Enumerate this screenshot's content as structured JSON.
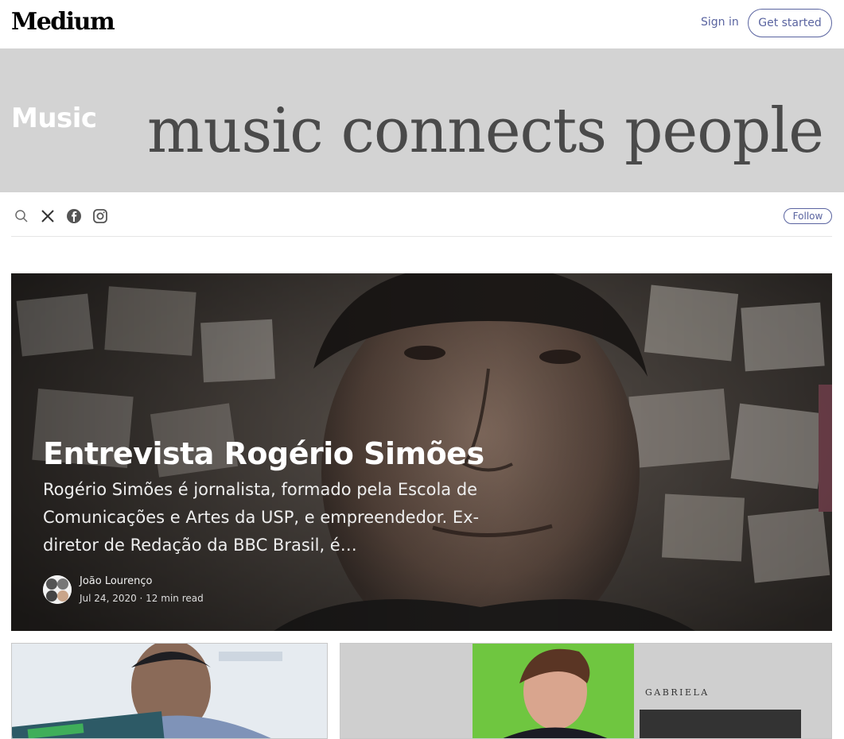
{
  "header": {
    "logo": "Medium",
    "sign_in": "Sign in",
    "get_started": "Get started"
  },
  "publication": {
    "name": "Music",
    "banner_text": "music connects people",
    "follow": "Follow",
    "social_icons": [
      "search-icon",
      "x-icon",
      "facebook-icon",
      "instagram-icon"
    ]
  },
  "hero": {
    "title": "Entrevista Rogério Simões",
    "subtitle": "Rogério Simões é jornalista, formado pela Escola de Comunicações e Artes da USP, e empreendedor. Ex-diretor de Redação da BBC Brasil, é…",
    "author": "João Lourenço",
    "meta": "Jul 24, 2020 · 12 min read"
  },
  "cards": {
    "second_label": "GABRIELA"
  },
  "colors": {
    "accent": "#5a64a0",
    "banner_bg": "#d3d3d3"
  }
}
